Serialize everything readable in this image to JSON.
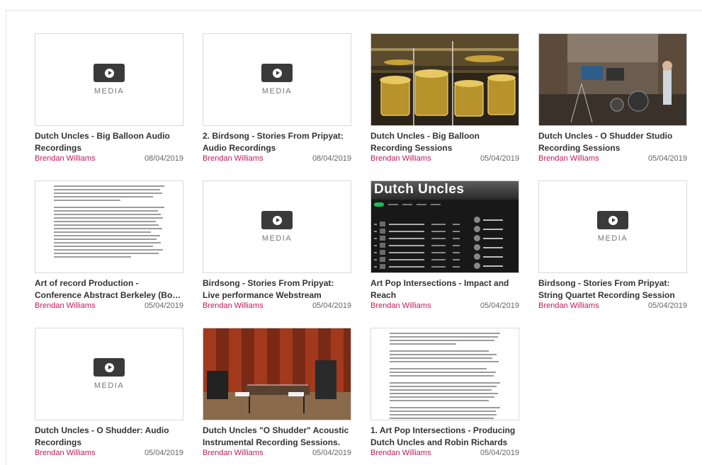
{
  "media_label": "MEDIA",
  "items": [
    {
      "thumb": "media",
      "title": "Dutch Uncles - Big Balloon Audio Recordings",
      "author": "Brendan Williams",
      "date": "08/04/2019"
    },
    {
      "thumb": "media",
      "title": "2. Birdsong - Stories From Pripyat: Audio Recordings",
      "author": "Brendan Williams",
      "date": "08/04/2019"
    },
    {
      "thumb": "photo-drums",
      "title": "Dutch Uncles - Big Balloon Recording Sessions",
      "author": "Brendan Williams",
      "date": "05/04/2019"
    },
    {
      "thumb": "photo-studio",
      "title": "Dutch Uncles - O Shudder Studio Recording Sessions",
      "author": "Brendan Williams",
      "date": "05/04/2019"
    },
    {
      "thumb": "doc",
      "title": "Art of record Production - Conference Abstract Berkeley (Bo…",
      "author": "Brendan Williams",
      "date": "05/04/2019"
    },
    {
      "thumb": "media",
      "title": "Birdsong - Stories From Pripyat: Live performance Webstream",
      "author": "Brendan Williams",
      "date": "05/04/2019"
    },
    {
      "thumb": "spotify",
      "title": "Art Pop Intersections - Impact and Reach",
      "author": "Brendan Williams",
      "date": "05/04/2019",
      "thumb_text": "Dutch Uncles"
    },
    {
      "thumb": "media",
      "title": "Birdsong - Stories From Pripyat: String Quartet Recording Session",
      "author": "Brendan Williams",
      "date": "05/04/2019"
    },
    {
      "thumb": "media",
      "title": "Dutch Uncles - O Shudder: Audio Recordings",
      "author": "Brendan Williams",
      "date": "05/04/2019"
    },
    {
      "thumb": "photo-stage",
      "title": "Dutch Uncles \"O Shudder\" Acoustic Instrumental Recording Sessions.",
      "author": "Brendan Williams",
      "date": "05/04/2019"
    },
    {
      "thumb": "doc",
      "title": "1. Art Pop Intersections - Producing Dutch Uncles and Robin Richards",
      "author": "Brendan Williams",
      "date": "05/04/2019"
    }
  ],
  "colors": {
    "author": "#c2185b",
    "play_box": "#3a3a3a"
  }
}
